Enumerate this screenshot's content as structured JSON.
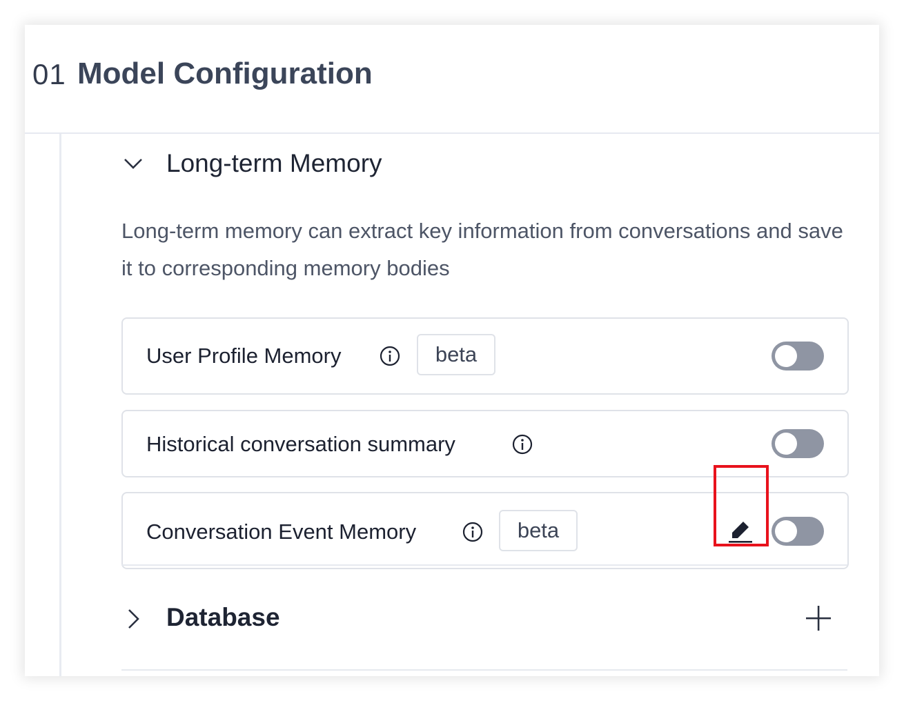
{
  "section": {
    "number": "01",
    "title": "Model Configuration"
  },
  "long_term_memory": {
    "title": "Long-term Memory",
    "description": "Long-term memory can extract key information from conversations and save it to corresponding memory bodies",
    "items": [
      {
        "label": "User Profile Memory",
        "badge": "beta",
        "enabled": false
      },
      {
        "label": "Historical conversation summary",
        "enabled": false
      },
      {
        "label": "Conversation Event Memory",
        "badge": "beta",
        "enabled": false
      }
    ]
  },
  "database": {
    "title": "Database"
  },
  "colors": {
    "highlight": "#e8121c",
    "toggle_off": "#8f95a3",
    "title_text": "#3b4559"
  },
  "icons": [
    "chevron-down-icon",
    "info-icon",
    "edit-pencil-icon",
    "chevron-right-icon",
    "plus-icon"
  ]
}
